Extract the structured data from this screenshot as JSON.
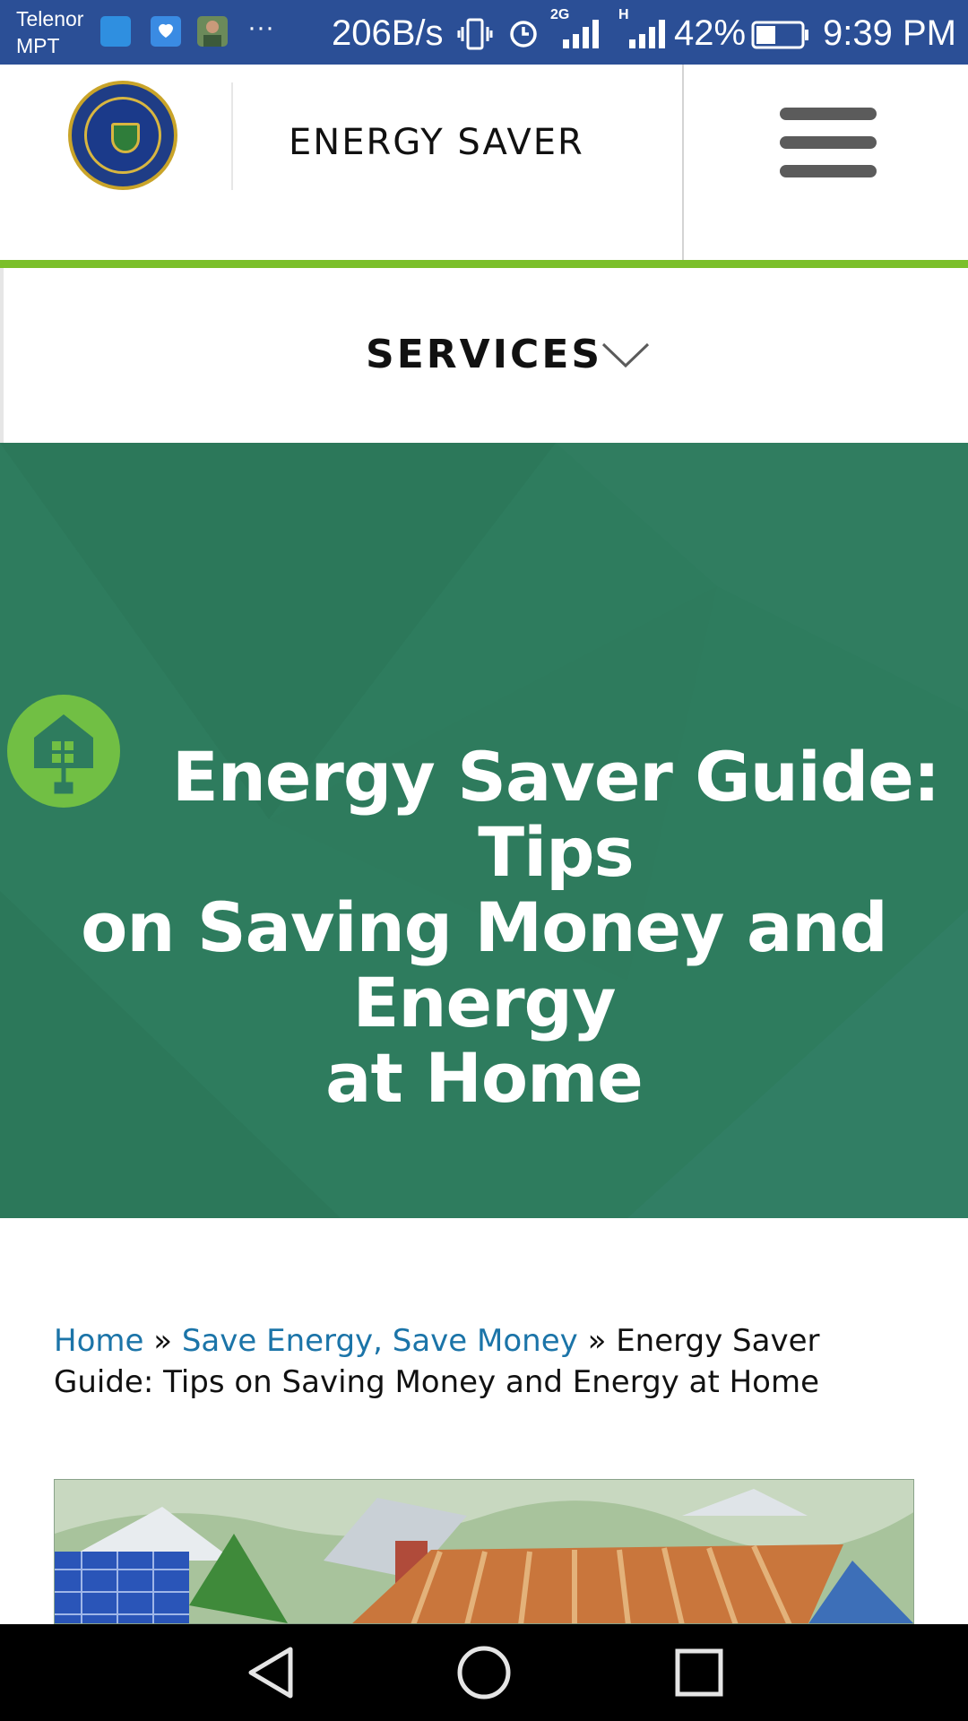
{
  "status_bar": {
    "carrier_line1": "Telenor",
    "carrier_line2": "MPT",
    "more": "···",
    "network_speed": "206B/s",
    "network_2g": "2G",
    "network_h": "H",
    "battery_percent": "42%",
    "battery_level": 0.42,
    "time": "9:39 PM"
  },
  "header": {
    "site_title": "ENERGY SAVER",
    "logo_icon": "department-of-energy-seal",
    "menu_icon": "hamburger-icon"
  },
  "services": {
    "label": "SERVICES",
    "chevron_icon": "chevron-down-icon"
  },
  "hero": {
    "title_line1": "Energy Saver Guide: Tips",
    "title_line2": "on Saving Money and Energy",
    "title_line3": "at Home",
    "icon": "house-plug-icon",
    "background_color": "#2e7c5e"
  },
  "breadcrumb": {
    "home": "Home",
    "separator": "»",
    "parent": "Save Energy, Save Money",
    "current": "Energy Saver Guide: Tips on Saving Money and Energy at Home"
  },
  "article_image": {
    "icon": "house-illustration"
  },
  "nav_bar": {
    "back_icon": "back-triangle-icon",
    "home_icon": "home-circle-icon",
    "recents_icon": "recents-square-icon"
  },
  "colors": {
    "status_bar": "#2b4f96",
    "accent_green": "#7bbf2a",
    "link_blue": "#1b74a8"
  }
}
